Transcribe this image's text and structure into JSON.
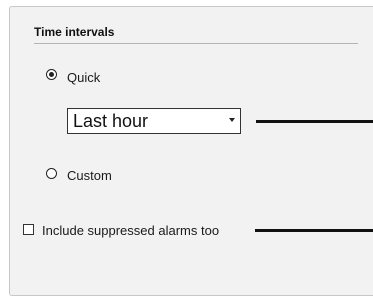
{
  "section": {
    "title": "Time intervals"
  },
  "quick": {
    "label": "Quick",
    "selected": true
  },
  "interval_select": {
    "value": "Last hour"
  },
  "custom": {
    "label": "Custom",
    "selected": false
  },
  "suppressed": {
    "label": "Include suppressed alarms too",
    "checked": false
  },
  "icons": {
    "dropdown": "chevron-down-icon"
  }
}
